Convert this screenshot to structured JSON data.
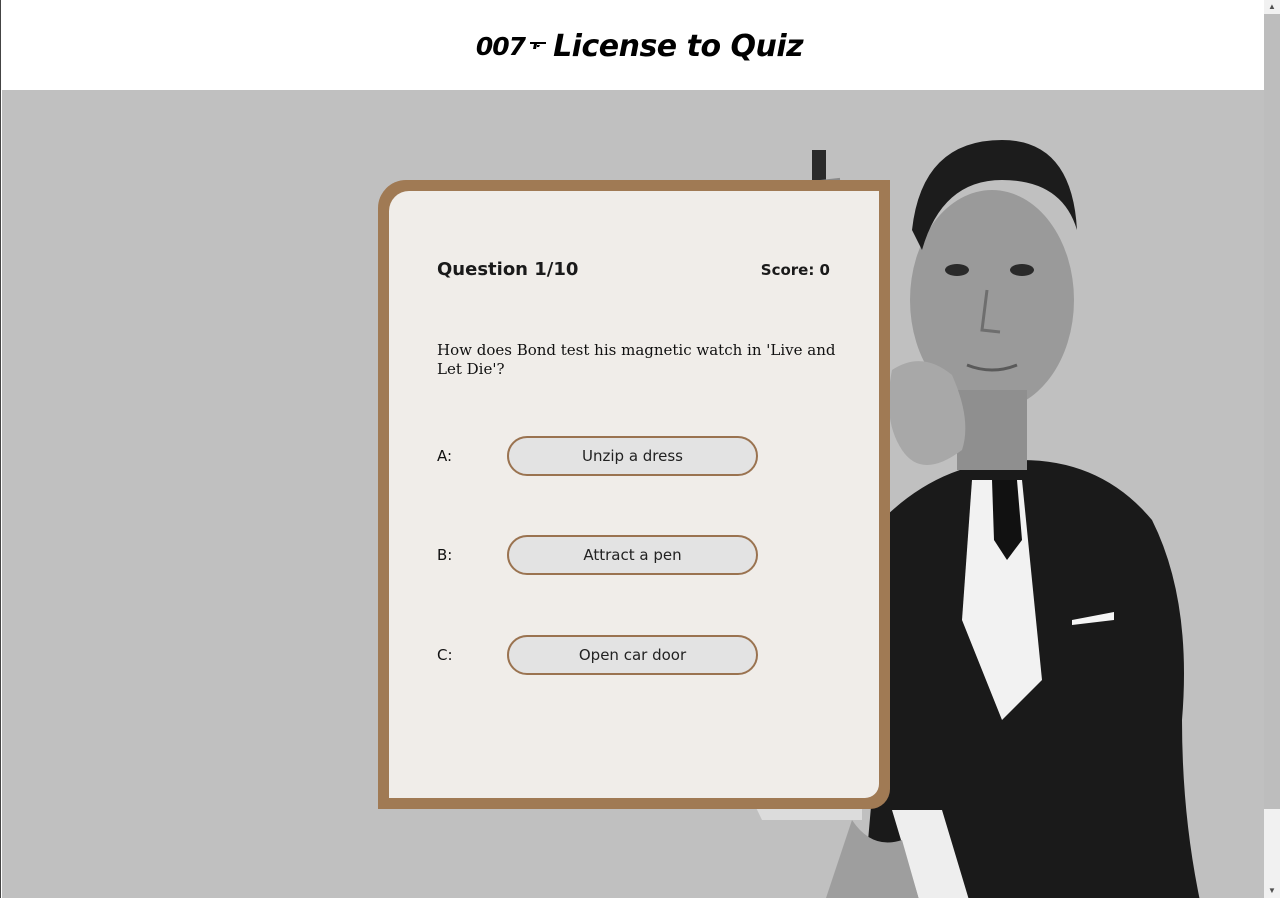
{
  "header": {
    "logo_text": "007",
    "title": "License to Quiz"
  },
  "quiz": {
    "question_counter": "Question 1/10",
    "score": "Score: 0",
    "question_text": "How does Bond test his magnetic watch in 'Live and Let Die'?",
    "answers": [
      {
        "letter": "A:",
        "text": "Unzip a dress"
      },
      {
        "letter": "B:",
        "text": "Attract a pen"
      },
      {
        "letter": "C:",
        "text": "Open car door"
      }
    ]
  },
  "colors": {
    "frame": "#a07a54",
    "background": "#c0c0c0",
    "button_border": "#9a7350"
  },
  "icons": {
    "logo_gun": "007-gun-logo-icon",
    "scroll_up": "scroll-up-arrow-icon",
    "scroll_down": "scroll-down-arrow-icon"
  }
}
